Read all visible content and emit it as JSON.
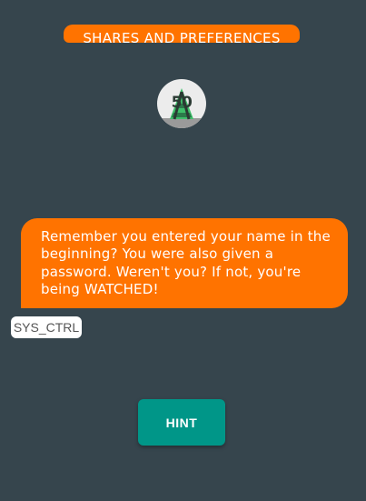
{
  "header": {
    "title": "SHARES AND PREFERENCES"
  },
  "score_badge": {
    "value": "50",
    "icon": "cone-icon"
  },
  "chat": {
    "message": "Remember you entered your name in the beginning? You were also given a password. Weren't you? If not, you're being WATCHED!",
    "sender": "SYS_CTRL"
  },
  "actions": {
    "hint_label": "HINT"
  },
  "colors": {
    "background": "#36454d",
    "accent_orange": "#ff7300",
    "button_teal": "#009688",
    "badge_green": "#3fbf6a"
  }
}
